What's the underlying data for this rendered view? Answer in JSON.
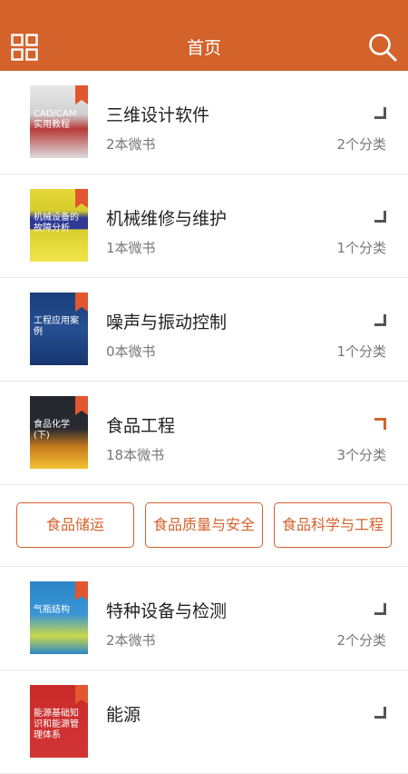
{
  "header": {
    "title": "首页",
    "menu_icon": "grid-icon",
    "search_icon": "search-icon"
  },
  "colors": {
    "brand": "#d4622b",
    "text_primary": "#222222",
    "text_secondary": "#777777"
  },
  "items": [
    {
      "name": "三维设计软件",
      "count": "2本微书",
      "cats": "2个分类",
      "cover_text": "CAD/CAM实用教程"
    },
    {
      "name": "机械维修与维护",
      "count": "1本微书",
      "cats": "1个分类",
      "cover_text": "机械设备的故障分析"
    },
    {
      "name": "噪声与振动控制",
      "count": "0本微书",
      "cats": "1个分类",
      "cover_text": "工程应用案例"
    },
    {
      "name": "食品工程",
      "count": "18本微书",
      "cats": "3个分类",
      "cover_text": "食品化学(下)"
    },
    {
      "name": "特种设备与检测",
      "count": "2本微书",
      "cats": "2个分类",
      "cover_text": "气瓶结构"
    },
    {
      "name": "能源",
      "count": "",
      "cats": "",
      "cover_text": "能源基础知识和能源管理体系"
    }
  ],
  "subcategories": [
    "食品储运",
    "食品质量与安全",
    "食品科学与工程"
  ]
}
